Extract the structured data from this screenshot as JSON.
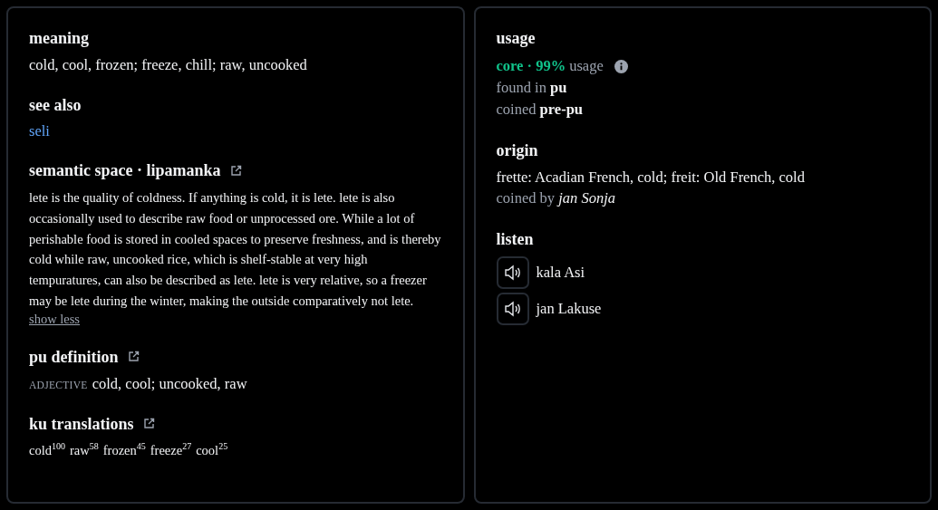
{
  "meaning": {
    "heading": "meaning",
    "text": "cold, cool, frozen; freeze, chill; raw, uncooked"
  },
  "see_also": {
    "heading": "see also",
    "links": [
      "seli"
    ]
  },
  "semantic_space": {
    "heading": "semantic space · lipamanka",
    "description": "lete is the quality of coldness. If anything is cold, it is lete. lete is also occasionally used to describe raw food or unprocessed ore. While a lot of perishable food is stored in cooled spaces to preserve freshness, and is thereby cold while raw, uncooked rice, which is shelf-stable at very high tempuratures, can also be described as lete. lete is very relative, so a freezer may be lete during the winter, making the outside comparatively not lete.",
    "toggle": "show less"
  },
  "pu_definition": {
    "heading": "pu definition",
    "part_of_speech": "ADJECTIVE",
    "text": "cold, cool; uncooked, raw"
  },
  "ku_translations": {
    "heading": "ku translations",
    "items": [
      {
        "word": "cold",
        "score": "100"
      },
      {
        "word": "raw",
        "score": "58"
      },
      {
        "word": "frozen",
        "score": "45"
      },
      {
        "word": "freeze",
        "score": "27"
      },
      {
        "word": "cool",
        "score": "25"
      }
    ]
  },
  "usage": {
    "heading": "usage",
    "category": "core · 99%",
    "label": "usage",
    "found_in": "found in **pu**",
    "coined": "coined **pre-pu**"
  },
  "origin": {
    "heading": "origin",
    "text": "frette: Acadian French, cold; freit: Old French, cold",
    "coined_by": "coined by *jan Sonja*"
  },
  "listen": {
    "heading": "listen",
    "recordings": [
      {
        "speaker": "kala Asi"
      },
      {
        "speaker": "jan Lakuse"
      }
    ]
  }
}
